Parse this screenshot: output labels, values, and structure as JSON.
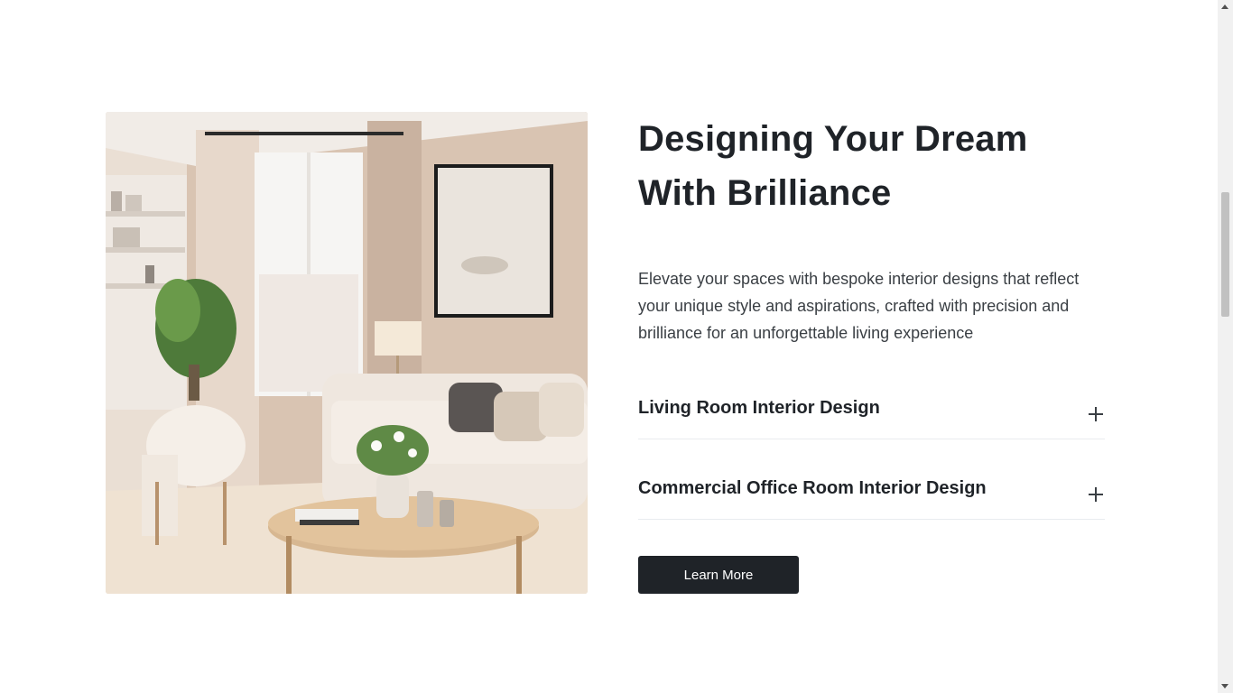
{
  "section": {
    "title": "Designing Your Dream With Brilliance",
    "description": "Elevate your spaces with bespoke interior designs that reflect your unique style and aspirations, crafted with precision and brilliance for an unforgettable living experience",
    "accordion": [
      {
        "label": "Living Room Interior Design"
      },
      {
        "label": "Commercial Office Room Interior Design"
      }
    ],
    "button_label": "Learn More",
    "image_alt": "living-room-interior-photo"
  },
  "colors": {
    "text": "#1f2328",
    "button_bg": "#1f2328",
    "divider": "#e9ecef"
  },
  "scrollbar": {
    "position_fraction": 0.3
  }
}
